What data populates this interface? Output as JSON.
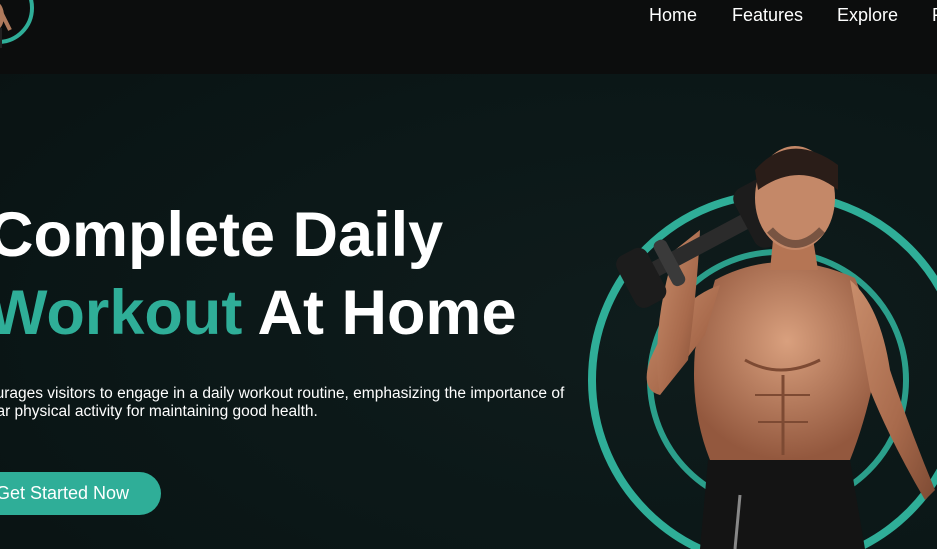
{
  "nav": {
    "links": [
      "Home",
      "Features",
      "Explore",
      "F"
    ]
  },
  "hero": {
    "title_line1": "Complete Daily",
    "title_accent": "Workout",
    "title_line2_rest": " At Home",
    "description": "encourages visitors to engage in a daily workout routine, emphasizing the importance of regular physical activity for maintaining good health.",
    "cta_label": "Get Started Now"
  },
  "colors": {
    "accent": "#2fae98",
    "background": "#0b1717",
    "navbar": "#0c0d0d"
  },
  "icons": {
    "logo": "athlete-logo-icon",
    "hero_image": "muscular-man-with-dumbbell-image"
  }
}
